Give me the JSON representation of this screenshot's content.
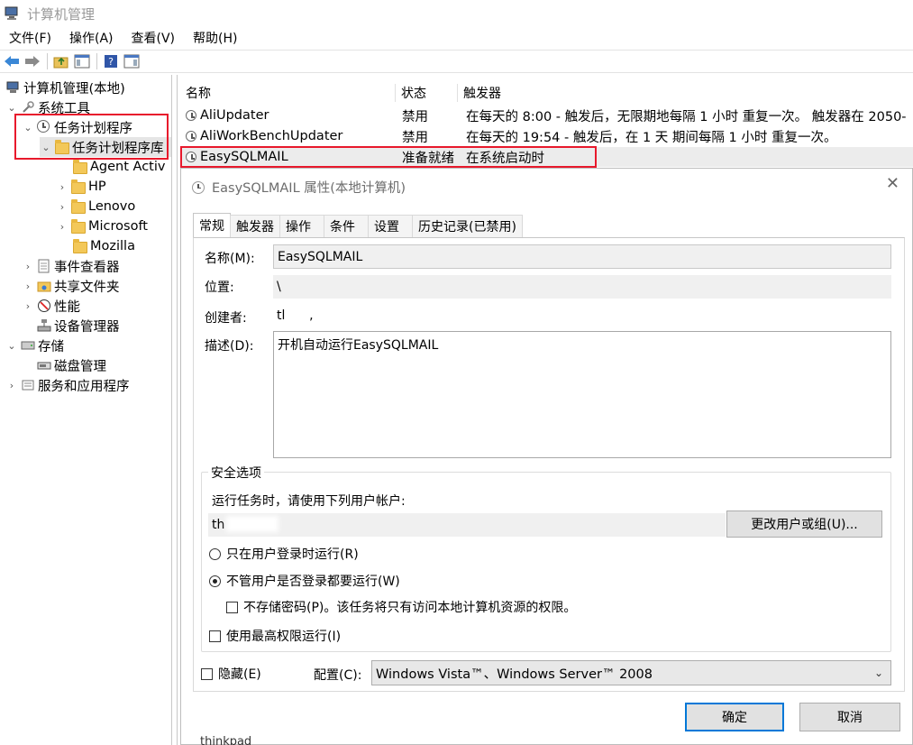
{
  "window": {
    "title": "计算机管理",
    "menu": [
      "文件(F)",
      "操作(A)",
      "查看(V)",
      "帮助(H)"
    ]
  },
  "tree": [
    {
      "label": "计算机管理(本地)",
      "icon": "computer-management-icon"
    },
    {
      "label": "系统工具",
      "icon": "tools-icon"
    },
    {
      "label": "任务计划程序",
      "icon": "clock-icon"
    },
    {
      "label": "任务计划程序库",
      "icon": "folder-clock-icon"
    },
    {
      "label": "Agent Activ",
      "icon": "folder-icon"
    },
    {
      "label": "HP",
      "icon": "folder-icon"
    },
    {
      "label": "Lenovo",
      "icon": "folder-icon"
    },
    {
      "label": "Microsoft",
      "icon": "folder-icon"
    },
    {
      "label": "Mozilla",
      "icon": "folder-icon"
    },
    {
      "label": "事件查看器",
      "icon": "event-viewer-icon"
    },
    {
      "label": "共享文件夹",
      "icon": "shared-folder-icon"
    },
    {
      "label": "性能",
      "icon": "performance-icon"
    },
    {
      "label": "设备管理器",
      "icon": "device-manager-icon"
    },
    {
      "label": "存储",
      "icon": "storage-icon"
    },
    {
      "label": "磁盘管理",
      "icon": "disk-icon"
    },
    {
      "label": "服务和应用程序",
      "icon": "services-icon"
    }
  ],
  "list": {
    "headers": [
      "名称",
      "状态",
      "触发器"
    ],
    "rows": [
      {
        "name": "AliUpdater",
        "status": "禁用",
        "trigger": "在每天的 8:00 - 触发后，无限期地每隔 1 小时 重复一次。 触发器在 2050-"
      },
      {
        "name": "AliWorkBenchUpdater",
        "status": "禁用",
        "trigger": "在每天的 19:54 - 触发后，在 1 天 期间每隔 1 小时 重复一次。"
      },
      {
        "name": "EasySQLMAIL",
        "status": "准备就绪",
        "trigger": "在系统启动时"
      }
    ]
  },
  "dialog": {
    "title": "EasySQLMAIL 属性(本地计算机)",
    "tabs": [
      "常规",
      "触发器",
      "操作",
      "条件",
      "设置",
      "历史记录(已禁用)"
    ],
    "name_label": "名称(M):",
    "name_value": "EasySQLMAIL",
    "location_label": "位置:",
    "location_value": "\\",
    "author_label": "创建者:",
    "author_value": "tl      ,",
    "desc_label": "描述(D):",
    "desc_value": "开机自动运行EasySQLMAIL",
    "security_title": "安全选项",
    "run_as_label": "运行任务时，请使用下列用户帐户:",
    "run_as_value": "th",
    "change_user_button": "更改用户或组(U)...",
    "radio_logged_on": "只在用户登录时运行(R)",
    "radio_whether": "不管用户是否登录都要运行(W)",
    "no_store_password": "不存储密码(P)。该任务将只有访问本地计算机资源的权限。",
    "highest_privileges": "使用最高权限运行(I)",
    "hidden_label": "隐藏(E)",
    "config_label": "配置(C):",
    "config_value": "Windows Vista™、Windows Server™ 2008",
    "ok_button": "确定",
    "cancel_button": "取消"
  },
  "behind_text": "thinkpad"
}
